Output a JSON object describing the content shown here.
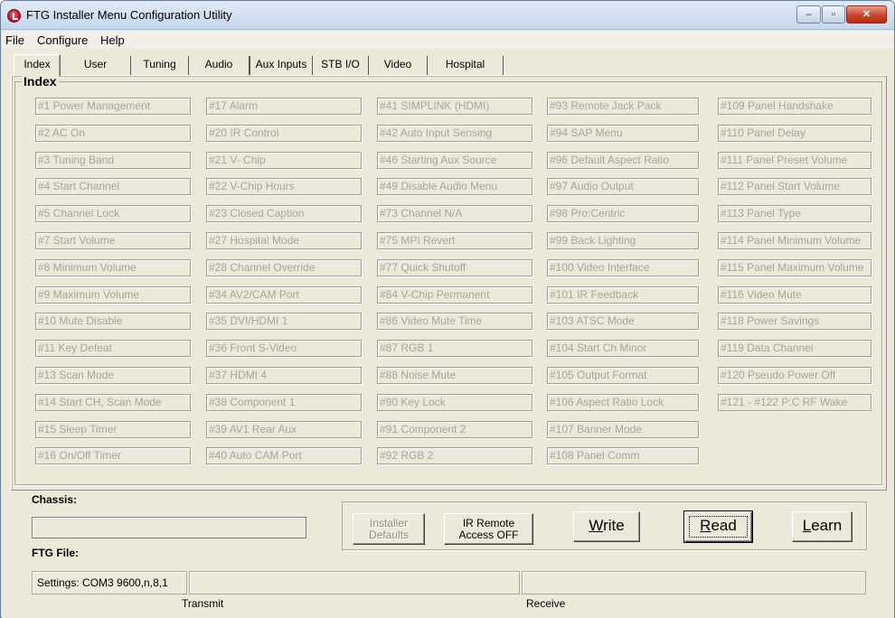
{
  "window": {
    "title": "FTG Installer Menu Configuration Utility",
    "controls": {
      "minimize": "–",
      "maximize": "▫",
      "close": "✕"
    }
  },
  "menubar": [
    "File",
    "Configure",
    "Help"
  ],
  "tabs": [
    "Index",
    "User",
    "Tuning",
    "Audio",
    "Aux Inputs",
    "STB I/O",
    "Video",
    "Hospital"
  ],
  "active_tab": "Index",
  "index_group": {
    "title": "Index",
    "columns": [
      [
        "#1 Power Management",
        "#2 AC On",
        "#3 Tuning Band",
        "#4 Start Channel",
        "#5 Channel Lock",
        "#7 Start Volume",
        "#8 Minimum Volume",
        "#9 Maximum Volume",
        "#10 Mute Disable",
        "#11 Key Defeat",
        "#13 Scan Mode",
        "#14 Start CH, Scan Mode",
        "#15 Sleep Timer",
        "#16 On/Off Timer"
      ],
      [
        "#17 Alarm",
        "#20 IR Control",
        "#21 V- Chip",
        "#22 V-Chip Hours",
        "#23 Closed Caption",
        "#27 Hospital Mode",
        "#28 Channel Override",
        "#34 AV2/CAM Port",
        "#35 DVI/HDMI 1",
        "#36 Front S-Video",
        "#37 HDMI 4",
        "#38 Component 1",
        "#39 AV1 Rear Aux",
        "#40 Auto CAM Port"
      ],
      [
        "#41 SIMPLINK (HDMI)",
        "#42 Auto Input Sensing",
        "#46 Starting Aux Source",
        "#49 Disable Audio Menu",
        "#73 Channel N/A",
        "#75 MPI Revert",
        "#77 Quick Shutoff",
        "#84 V-Chip Permanent",
        "#86 Video Mute Time",
        "#87 RGB 1",
        "#88 Noise Mute",
        "#90 Key Lock",
        "#91 Component 2",
        "#92 RGB 2"
      ],
      [
        "#93 Remote Jack Pack",
        "#94 SAP Menu",
        "#96 Default Aspect Ratio",
        "#97 Audio Output",
        "#98 Pro:Centric",
        "#99 Back Lighting",
        "#100 Video Interface",
        "#101 IR Feedback",
        "#103 ATSC Mode",
        "#104 Start Ch Minor",
        "#105 Output Format",
        "#106 Aspect Ratio Lock",
        "#107 Banner Mode",
        "#108 Panel Comm"
      ],
      [
        "#109 Panel Handshake",
        "#110 Panel Delay",
        "#111 Panel Preset Volume",
        "#112 Panel Start Volume",
        "#113 Panel Type",
        "#114 Panel Minimum Volume",
        "#115 Panel Maximum Volume",
        "#116 Video Mute",
        "#118 Power Savings",
        "#119 Data Channel",
        "#120 Pseudo Power Off",
        "#121 - #122 P:C RF Wake"
      ]
    ]
  },
  "chassis": {
    "label": "Chassis:",
    "value": ""
  },
  "ftg_file": {
    "label": "FTG File:"
  },
  "buttons": {
    "installer_defaults": [
      "Installer",
      "Defaults"
    ],
    "ir_remote": [
      "IR Remote",
      "Access OFF"
    ],
    "write": {
      "mnemonic": "W",
      "rest": "rite"
    },
    "read": {
      "mnemonic": "R",
      "rest": "ead"
    },
    "learn": {
      "mnemonic": "L",
      "rest": "earn"
    }
  },
  "status": {
    "settings": "Settings: COM3 9600,n,8,1",
    "transmit_label": "Transmit",
    "receive_label": "Receive"
  }
}
